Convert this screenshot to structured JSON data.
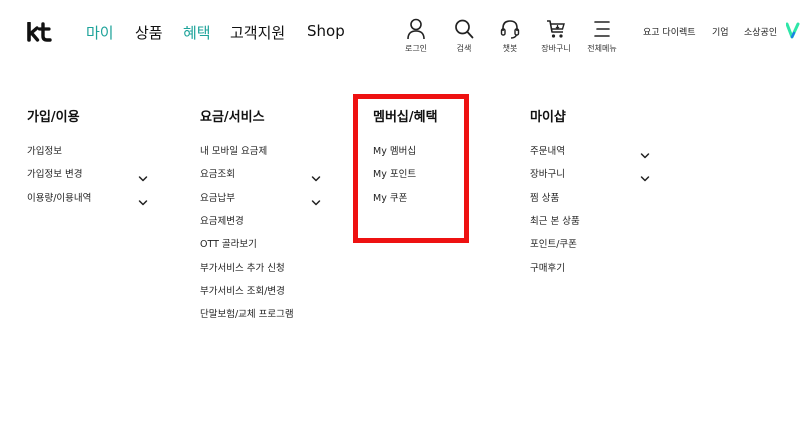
{
  "header": {
    "logo_text": "kt",
    "nav": [
      "마이",
      "상품",
      "혜택",
      "고객지원",
      "Shop"
    ],
    "nav_colors": [
      "#1ea39a",
      "#111111",
      "#1ea39a",
      "#111111",
      "#111111"
    ],
    "icons": [
      {
        "name": "user-icon",
        "label": "로그인"
      },
      {
        "name": "search-icon",
        "label": "검색"
      },
      {
        "name": "headset-icon",
        "label": "챗봇"
      },
      {
        "name": "cart-icon",
        "label": "장바구니"
      },
      {
        "name": "menu-icon",
        "label": "전체메뉴"
      }
    ],
    "links": [
      "요고 다이렉트",
      "기업",
      "소상공인"
    ],
    "brand_accent": "#2ee6a8"
  },
  "columns": [
    {
      "title": "가입/이용",
      "items": [
        {
          "label": "가입정보",
          "expand": false
        },
        {
          "label": "가입정보 변경",
          "expand": true
        },
        {
          "label": "이용량/이용내역",
          "expand": true
        }
      ]
    },
    {
      "title": "요금/서비스",
      "items": [
        {
          "label": "내 모바일 요금제",
          "expand": false
        },
        {
          "label": "요금조회",
          "expand": true
        },
        {
          "label": "요금납부",
          "expand": true
        },
        {
          "label": "요금제변경",
          "expand": false
        },
        {
          "label": "OTT 골라보기",
          "expand": false
        },
        {
          "label": "부가서비스 추가 신청",
          "expand": false
        },
        {
          "label": "부가서비스 조회/변경",
          "expand": false
        },
        {
          "label": "단말보험/교체 프로그램",
          "expand": false
        }
      ]
    },
    {
      "title": "멤버십/혜택",
      "items": [
        {
          "label": "My 멤버십",
          "expand": false
        },
        {
          "label": "My 포인트",
          "expand": false
        },
        {
          "label": "My 쿠폰",
          "expand": false
        }
      ]
    },
    {
      "title": "마이샵",
      "items": [
        {
          "label": "주문내역",
          "expand": true
        },
        {
          "label": "장바구니",
          "expand": true
        },
        {
          "label": "찜 상품",
          "expand": false
        },
        {
          "label": "최근 본 상품",
          "expand": false
        },
        {
          "label": "포인트/쿠폰",
          "expand": false
        },
        {
          "label": "구매후기",
          "expand": false
        }
      ]
    }
  ],
  "highlight_color": "#ee1111"
}
